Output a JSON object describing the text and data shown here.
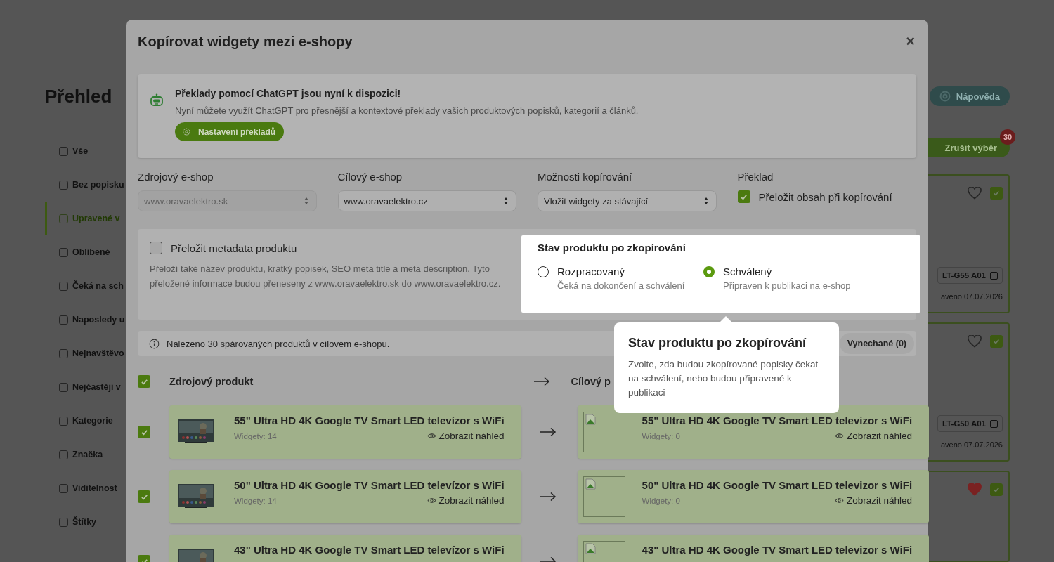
{
  "page": {
    "heading": "Přehled",
    "sidebar": [
      {
        "label": "Vše",
        "selected": false
      },
      {
        "label": "Bez popisku",
        "selected": false
      },
      {
        "label": "Upravené v",
        "selected": true
      },
      {
        "label": "Oblíbené",
        "selected": false
      },
      {
        "label": "Čeká na sch",
        "selected": false
      },
      {
        "label": "Naposledy u",
        "selected": false
      },
      {
        "label": "Nejnavštěvo",
        "selected": false
      },
      {
        "label": "Nejčastěji v",
        "selected": false
      },
      {
        "label": "Kategorie",
        "selected": false
      },
      {
        "label": "Značka",
        "selected": false
      },
      {
        "label": "Viditelnost",
        "selected": false
      },
      {
        "label": "Štítky",
        "selected": false
      }
    ],
    "help_button": "Nápověda",
    "clear_button": "Zrušit výběr",
    "selection_badge": "30",
    "cards": [
      {
        "code": "LT-G55 A01",
        "date": "aveno 07.07.2026",
        "favorite": false,
        "checked": true
      },
      {
        "code": "LT-G50 A01",
        "date": "aveno 07.07.2026",
        "favorite": false,
        "checked": true
      },
      {
        "favorite": true,
        "checked": true
      }
    ]
  },
  "modal": {
    "title": "Kopírovat widgety mezi e-shopy",
    "close": "×",
    "notice": {
      "title": "Překlady pomocí ChatGPT jsou nyní k dispozici!",
      "text": "Nyní můžete využít ChatGPT pro přesnější a kontextové překlady vašich produktových popisků, kategorií a článků.",
      "button": "Nastavení překladů"
    },
    "fields": [
      {
        "label": "Zdrojový e-shop",
        "value": "www.oravaelektro.sk",
        "disabled": true
      },
      {
        "label": "Cílový e-shop",
        "value": "www.oravaelektro.cz",
        "disabled": false
      },
      {
        "label": "Možnosti kopírování",
        "value": "Vložit widgety za stávající",
        "disabled": false
      }
    ],
    "translate": {
      "label": "Překlad",
      "option": "Přeložit obsah při kopírování",
      "checked": true
    },
    "metadata": {
      "label": "Přeložit metadata produktu",
      "checked": false,
      "description": "Přeloží také název produktu, krátký popisek, SEO meta title a meta description. Tyto přeložené informace budou přeneseny z www.oravaelektro.sk do www.oravaelektro.cz."
    },
    "status": {
      "title": "Stav produktu po zkopírování",
      "options": [
        {
          "label": "Rozpracovaný",
          "hint": "Čeká na dokončení a schválení",
          "selected": false
        },
        {
          "label": "Schválený",
          "hint": "Připraven k publikaci na e-shop",
          "selected": true
        }
      ]
    },
    "found_text": "Nalezeno 30 spárovaných produktů v cílovém e-shopu.",
    "filters": [
      {
        "label": "Vynechané (0)",
        "selected": false
      }
    ],
    "header": {
      "checked": true,
      "source": "Zdrojový produkt",
      "target": "Cílový p"
    },
    "products": [
      {
        "checked": true,
        "source": {
          "title": "55\" Ultra HD 4K Google TV Smart LED televízor s WiFi",
          "widgets": "Widgety: 14",
          "preview": "Zobrazit náhled"
        },
        "target": {
          "title": "55\" Ultra HD 4K Google TV Smart LED televizor s WiFi",
          "widgets": "Widgety: 0",
          "preview": "Zobrazit náhled"
        }
      },
      {
        "checked": true,
        "source": {
          "title": "50\" Ultra HD 4K Google TV Smart LED televízor s WiFi",
          "widgets": "Widgety: 14",
          "preview": "Zobrazit náhled"
        },
        "target": {
          "title": "50\" Ultra HD 4K Google TV Smart LED televizor s WiFi",
          "widgets": "Widgety: 0",
          "preview": "Zobrazit náhled"
        }
      },
      {
        "checked": true,
        "source": {
          "title": "43\" Ultra HD 4K Google TV Smart LED televízor s WiFi"
        },
        "target": {
          "title": "43\" Ultra HD 4K Google TV Smart LED televizor s WiFi"
        }
      }
    ],
    "tooltip": {
      "title": "Stav produktu po zkopírování",
      "text": "Zvolte, zda budou zkopírované popisky čekat na schválení, nebo budou připravené k publikaci"
    }
  }
}
